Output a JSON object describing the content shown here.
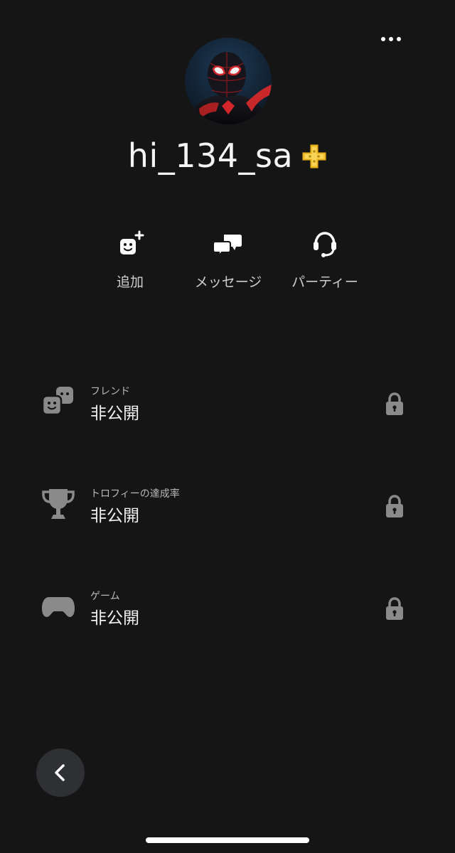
{
  "profile": {
    "username": "hi_134_sa",
    "avatar_icon": "avatar-image",
    "plus_badge_icon": "ps-plus-icon",
    "plus_badge_color": "#f2c230"
  },
  "header": {
    "more_icon": "more-horizontal-icon"
  },
  "actions": [
    {
      "label": "追加",
      "icon": "add-friend-icon"
    },
    {
      "label": "メッセージ",
      "icon": "message-icon"
    },
    {
      "label": "パーティー",
      "icon": "headset-icon"
    }
  ],
  "info_rows": [
    {
      "title": "フレンド",
      "value": "非公開",
      "icon": "friends-icon",
      "lock_icon": "lock-icon"
    },
    {
      "title": "トロフィーの達成率",
      "value": "非公開",
      "icon": "trophy-icon",
      "lock_icon": "lock-icon"
    },
    {
      "title": "ゲーム",
      "value": "非公開",
      "icon": "gamepad-icon",
      "lock_icon": "lock-icon"
    }
  ],
  "footer": {
    "back_icon": "chevron-left-icon"
  },
  "colors": {
    "background": "#151515",
    "text_primary": "#f2f2f2",
    "text_secondary": "#b8b8b8",
    "icon_gray": "#8a8a8a",
    "back_button_bg": "#2f3033"
  }
}
